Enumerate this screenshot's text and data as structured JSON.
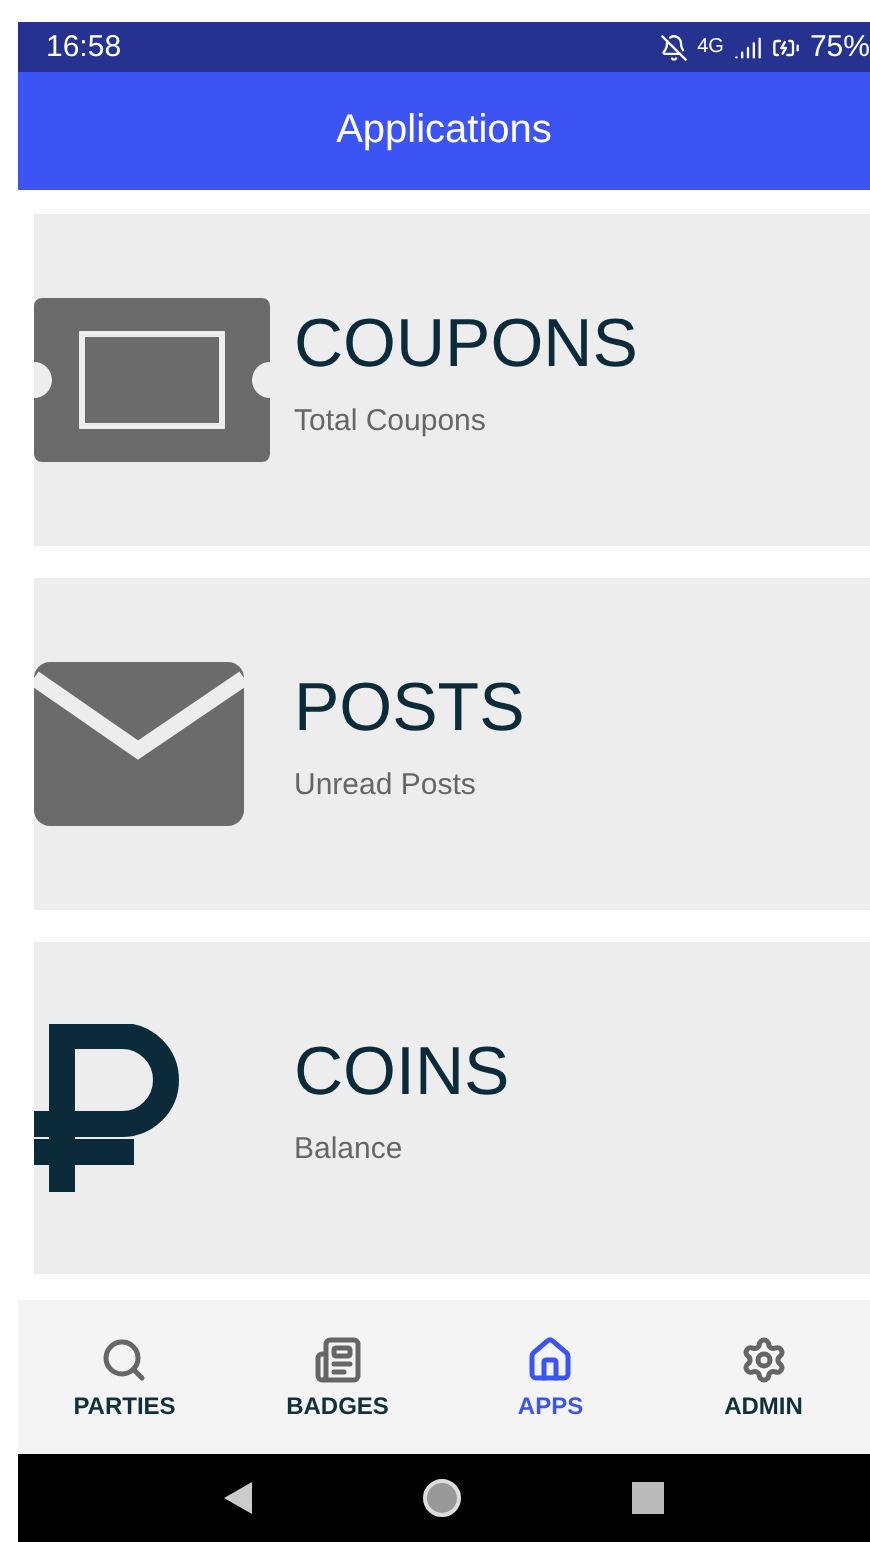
{
  "status_bar": {
    "time": "16:58",
    "network": "4G",
    "battery": "75%"
  },
  "app_bar": {
    "title": "Applications"
  },
  "cards": [
    {
      "title": "COUPONS",
      "subtitle": "Total Coupons"
    },
    {
      "title": "POSTS",
      "subtitle": "Unread Posts"
    },
    {
      "title": "COINS",
      "subtitle": "Balance"
    }
  ],
  "tabs": [
    {
      "label": "PARTIES",
      "selected": false
    },
    {
      "label": "BADGES",
      "selected": false
    },
    {
      "label": "APPS",
      "selected": true
    },
    {
      "label": "ADMIN",
      "selected": false
    }
  ]
}
